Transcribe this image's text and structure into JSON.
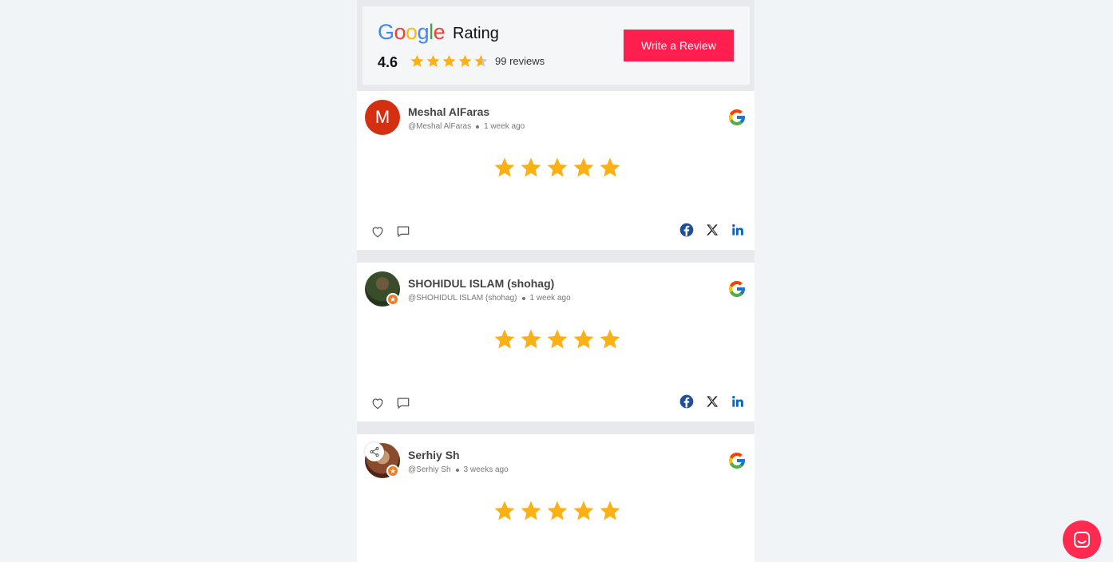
{
  "header": {
    "logo_letters": [
      "G",
      "o",
      "o",
      "g",
      "l",
      "e"
    ],
    "logo_colors": [
      "#4285F4",
      "#EA4335",
      "#FBBC05",
      "#4285F4",
      "#34A853",
      "#EA4335"
    ],
    "title": "Rating",
    "average": "4.6",
    "rating_value": 4.6,
    "reviews_count": "99 reviews",
    "write_button": "Write a Review",
    "accent_color": "#ff1f4e",
    "star_color": "#fbb115"
  },
  "reviews": [
    {
      "avatar_letter": "M",
      "avatar_type": "letter",
      "name": "Meshal AlFaras",
      "handle": "@Meshal AlFaras",
      "time": "1 week ago",
      "stars": 5
    },
    {
      "avatar_type": "photo",
      "name": "SHOHIDUL ISLAM (shohag)",
      "handle": "@SHOHIDUL ISLAM (shohag)",
      "time": "1 week ago",
      "stars": 5
    },
    {
      "avatar_type": "photo",
      "name": "Serhiy Sh",
      "handle": "@Serhiy Sh",
      "time": "3 weeks ago",
      "stars": 5
    }
  ],
  "icons": {
    "like": "heart-icon",
    "comment": "comment-icon",
    "facebook": "facebook-icon",
    "x": "x-icon",
    "linkedin": "linkedin-icon",
    "source": "google-icon",
    "chat": "chat-icon",
    "share": "share-icon"
  }
}
